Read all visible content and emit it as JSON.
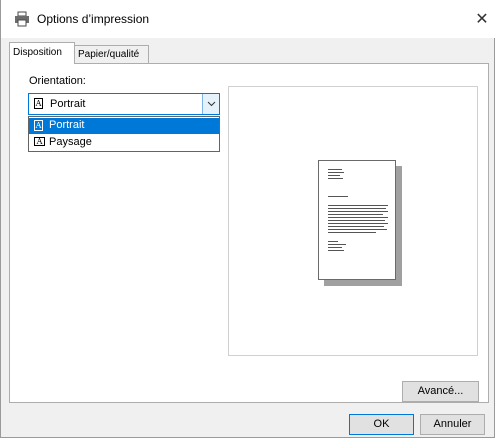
{
  "window": {
    "title": "Options d’impression",
    "close_glyph": "✕",
    "icon": "printer-icon"
  },
  "tabs": [
    {
      "label": "Disposition",
      "active": true
    },
    {
      "label": "Papier/qualité",
      "active": false
    }
  ],
  "orientation": {
    "label": "Orientation:",
    "selected": "Portrait",
    "options": [
      {
        "label": "Portrait",
        "icon": "portrait-page-icon"
      },
      {
        "label": "Paysage",
        "icon": "landscape-page-icon"
      }
    ],
    "icon_glyph": "A"
  },
  "buttons": {
    "advanced": "Avancé...",
    "ok": "OK",
    "cancel": "Annuler"
  },
  "colors": {
    "accent": "#0078d7",
    "dialog_bg": "#f0f0f0"
  }
}
